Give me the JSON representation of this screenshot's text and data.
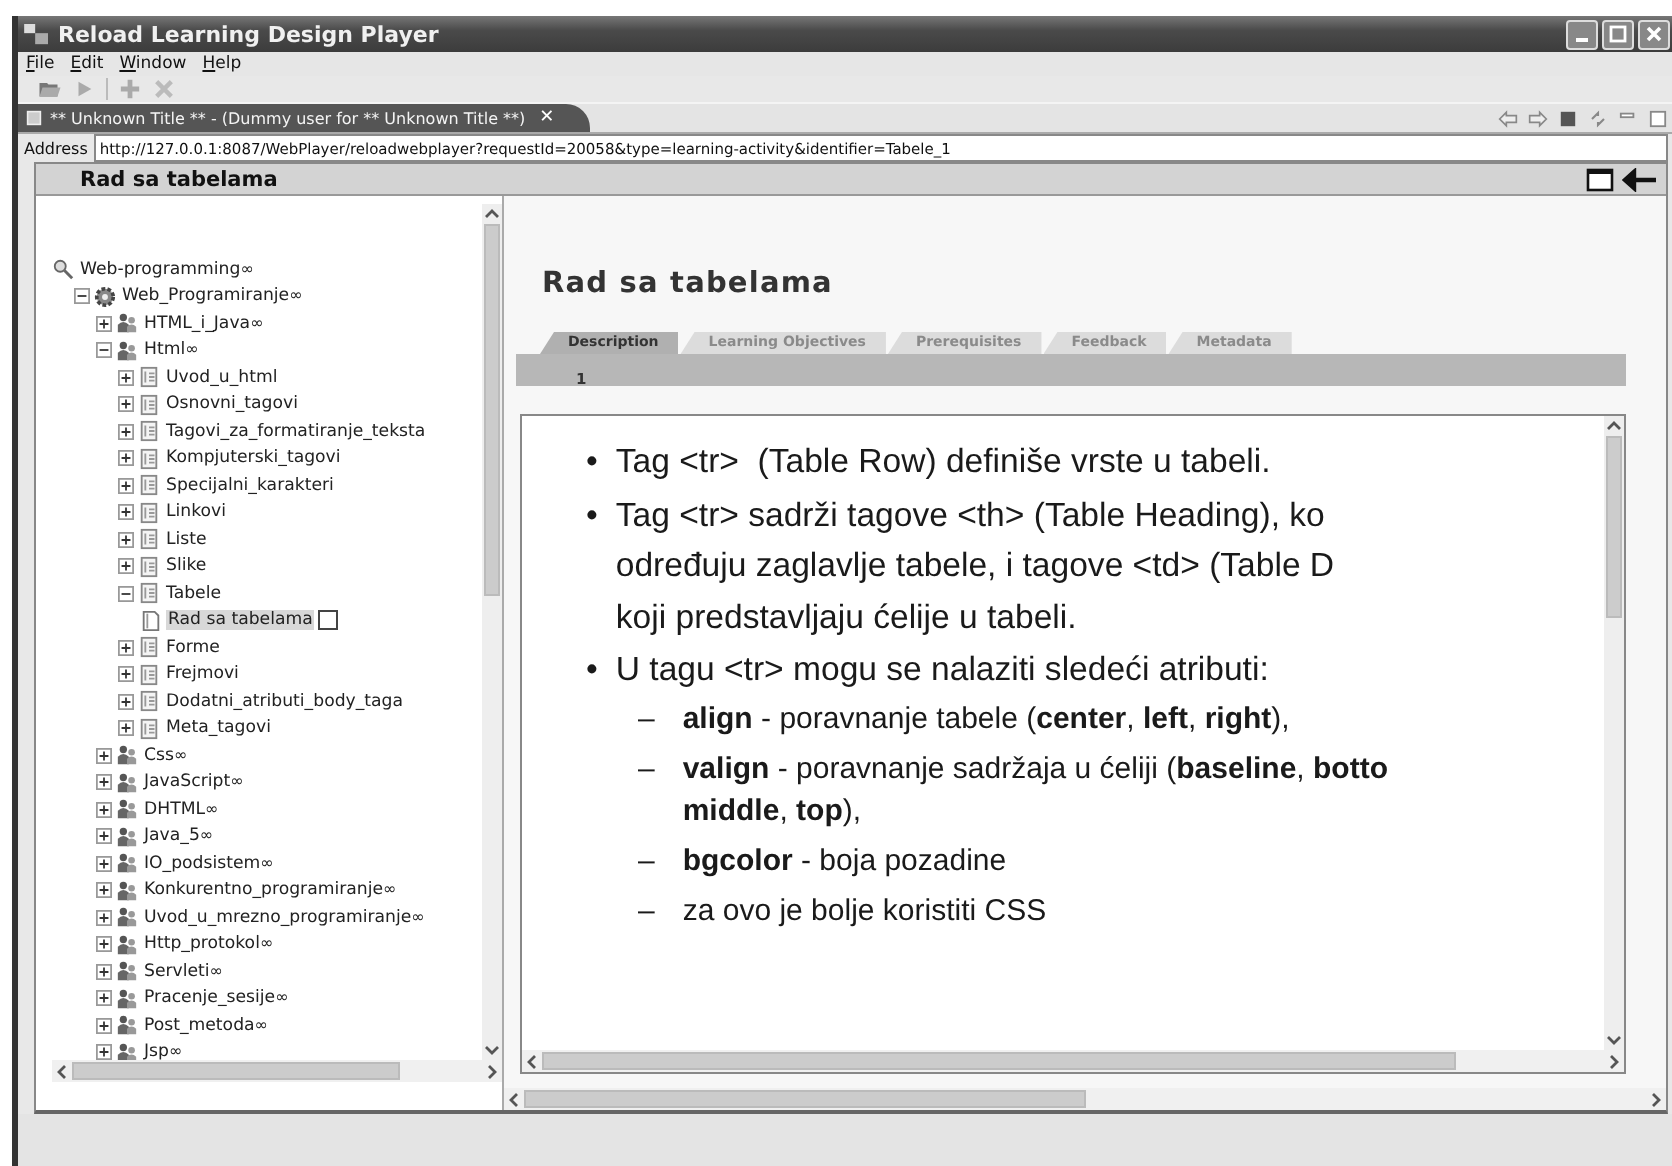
{
  "window": {
    "title": "Reload Learning Design Player"
  },
  "menu": [
    {
      "label": "File"
    },
    {
      "label": "Edit"
    },
    {
      "label": "Window"
    },
    {
      "label": "Help"
    }
  ],
  "editor_tab": {
    "title": "** Unknown Title ** - (Dummy user for ** Unknown Title **)",
    "close": "✕"
  },
  "address": {
    "label": "Address",
    "value": "http://127.0.0.1:8087/WebPlayer/reloadwebplayer?requestId=20058&type=learning-activity&identifier=Tabele_1"
  },
  "tree_panel": {
    "title": "Rad sa tabelama"
  },
  "tree": [
    {
      "label": "Web-programming",
      "kind": "search",
      "suffix": "∞",
      "selected": false,
      "children": [
        {
          "label": "Web_Programiranje",
          "kind": "gear",
          "suffix": "∞",
          "expanded": true,
          "selected": false,
          "children": [
            {
              "label": "HTML_i_Java",
              "kind": "people",
              "suffix": "∞",
              "expanded": false,
              "selected": false
            },
            {
              "label": "Html",
              "kind": "people",
              "suffix": "∞",
              "expanded": true,
              "selected": false,
              "children": [
                {
                  "label": "Uvod_u_html",
                  "kind": "doc",
                  "expanded": false,
                  "selected": false
                },
                {
                  "label": "Osnovni_tagovi",
                  "kind": "doc",
                  "expanded": false,
                  "selected": false
                },
                {
                  "label": "Tagovi_za_formatiranje_teksta",
                  "kind": "doc",
                  "expanded": false,
                  "selected": false
                },
                {
                  "label": "Kompjuterski_tagovi",
                  "kind": "doc",
                  "expanded": false,
                  "selected": false
                },
                {
                  "label": "Specijalni_karakteri",
                  "kind": "doc",
                  "expanded": false,
                  "selected": false
                },
                {
                  "label": "Linkovi",
                  "kind": "doc",
                  "expanded": false,
                  "selected": false
                },
                {
                  "label": "Liste",
                  "kind": "doc",
                  "expanded": false,
                  "selected": false
                },
                {
                  "label": "Slike",
                  "kind": "doc",
                  "expanded": false,
                  "selected": false
                },
                {
                  "label": "Tabele",
                  "kind": "doc",
                  "expanded": true,
                  "selected": false,
                  "children": [
                    {
                      "label": "Rad sa tabelama",
                      "kind": "page",
                      "selected": true,
                      "checked": false
                    }
                  ]
                },
                {
                  "label": "Forme",
                  "kind": "doc",
                  "expanded": false,
                  "selected": false
                },
                {
                  "label": "Frejmovi",
                  "kind": "doc",
                  "expanded": false,
                  "selected": false
                },
                {
                  "label": "Dodatni_atributi_body_taga",
                  "kind": "doc",
                  "expanded": false,
                  "selected": false
                },
                {
                  "label": "Meta_tagovi",
                  "kind": "doc",
                  "expanded": false,
                  "selected": false
                }
              ]
            },
            {
              "label": "Css",
              "kind": "people",
              "suffix": "∞",
              "expanded": false,
              "selected": false
            },
            {
              "label": "JavaScript",
              "kind": "people",
              "suffix": "∞",
              "expanded": false,
              "selected": false
            },
            {
              "label": "DHTML",
              "kind": "people",
              "suffix": "∞",
              "expanded": false,
              "selected": false
            },
            {
              "label": "Java_5",
              "kind": "people",
              "suffix": "∞",
              "expanded": false,
              "selected": false
            },
            {
              "label": "IO_podsistem",
              "kind": "people",
              "suffix": "∞",
              "expanded": false,
              "selected": false
            },
            {
              "label": "Konkurentno_programiranje",
              "kind": "people",
              "suffix": "∞",
              "expanded": false,
              "selected": false
            },
            {
              "label": "Uvod_u_mrezno_programiranje",
              "kind": "people",
              "suffix": "∞",
              "expanded": false,
              "selected": false
            },
            {
              "label": "Http_protokol",
              "kind": "people",
              "suffix": "∞",
              "expanded": false,
              "selected": false
            },
            {
              "label": "Servleti",
              "kind": "people",
              "suffix": "∞",
              "expanded": false,
              "selected": false
            },
            {
              "label": "Pracenje_sesije",
              "kind": "people",
              "suffix": "∞",
              "expanded": false,
              "selected": false
            },
            {
              "label": "Post_metoda",
              "kind": "people",
              "suffix": "∞",
              "expanded": false,
              "selected": false
            },
            {
              "label": "Jsp",
              "kind": "people",
              "suffix": "∞",
              "expanded": false,
              "selected": false
            }
          ]
        }
      ]
    }
  ],
  "activity": {
    "title": "Rad sa tabelama",
    "tabs": [
      {
        "label": "Description",
        "selected": true
      },
      {
        "label": "Learning Objectives",
        "selected": false
      },
      {
        "label": "Prerequisites",
        "selected": false
      },
      {
        "label": "Feedback",
        "selected": false
      },
      {
        "label": "Metadata",
        "selected": false
      }
    ],
    "page_number": "1",
    "items": [
      {
        "kind": "bullet",
        "marker": "•",
        "lines": [
          "Tag <tr>  (Table Row) definiše vrste u tabeli."
        ]
      },
      {
        "kind": "bullet",
        "marker": "•",
        "lines": [
          "Tag <tr> sadrži tagove <th> (Table Heading), ko",
          "određuju zaglavlje tabele, i tagove <td> (Table D",
          "koji predstavljaju ćelije u tabeli."
        ]
      },
      {
        "kind": "bullet",
        "marker": "•",
        "lines": [
          "U tagu <tr> mogu se nalaziti sledeći atributi:"
        ]
      },
      {
        "kind": "sub",
        "marker": "–",
        "lines": [
          "**align** - poravnanje tabele (**center**, **left**, **right**),"
        ]
      },
      {
        "kind": "sub",
        "marker": "–",
        "lines": [
          "**valign** - poravnanje sadržaja u ćeliji (**baseline**, **botto**",
          "**middle**, **top**),"
        ]
      },
      {
        "kind": "sub",
        "marker": "–",
        "lines": [
          "**bgcolor** - boja pozadine"
        ]
      },
      {
        "kind": "sub",
        "marker": "–",
        "lines": [
          "za ovo je bolje koristiti CSS"
        ]
      }
    ]
  }
}
